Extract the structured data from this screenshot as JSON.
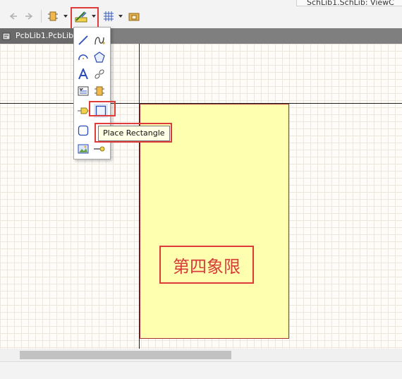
{
  "window": {
    "title_fragment": "SchLib1.SchLib: ViewC"
  },
  "toolbar": {
    "buttons": [
      {
        "name": "back-icon"
      },
      {
        "name": "forward-icon"
      },
      {
        "name": "component-icon"
      },
      {
        "name": "drawing-tools-icon",
        "active": true
      },
      {
        "name": "grid-icon"
      },
      {
        "name": "library-icon"
      }
    ]
  },
  "tabs": [
    {
      "label": "PcbLib1.PcbLib",
      "active": true
    }
  ],
  "dropdown": {
    "items": [
      "place-line-icon",
      "place-bezier-icon",
      "place-arc-icon",
      "place-polygon-icon",
      "place-text-icon",
      "place-link-icon",
      "place-text-frame-icon",
      "place-part-icon",
      "place-port-icon",
      "place-rectangle-icon",
      "place-round-rectangle-icon",
      "empty",
      "place-image-icon",
      "place-pin-icon"
    ],
    "selected": "place-rectangle-icon"
  },
  "tooltip": {
    "text": "Place Rectangle"
  },
  "canvas": {
    "annotation": "第四象限",
    "colors": {
      "rect_fill": "#ffffb0",
      "rect_border": "#a83030",
      "highlight": "#e03b3b",
      "axis": "#222222"
    }
  }
}
